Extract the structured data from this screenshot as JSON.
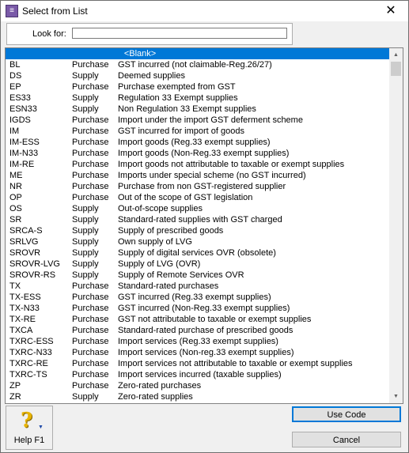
{
  "window": {
    "title": "Select from List",
    "app_icon": "purple-app-icon",
    "close_glyph": "✕"
  },
  "search": {
    "label": "Look for:",
    "value": "",
    "placeholder": ""
  },
  "list": {
    "blank_label": "<Blank>",
    "selected_index": 0,
    "rows": [
      {
        "code": "BL",
        "type": "Purchase",
        "description": "GST incurred (not claimable-Reg.26/27)"
      },
      {
        "code": "DS",
        "type": "Supply",
        "description": "Deemed supplies"
      },
      {
        "code": "EP",
        "type": "Purchase",
        "description": "Purchase exempted from GST"
      },
      {
        "code": "ES33",
        "type": "Supply",
        "description": "Regulation 33 Exempt supplies"
      },
      {
        "code": "ESN33",
        "type": "Supply",
        "description": "Non Regulation 33 Exempt supplies"
      },
      {
        "code": "IGDS",
        "type": "Purchase",
        "description": "Import under the import GST deferment scheme"
      },
      {
        "code": "IM",
        "type": "Purchase",
        "description": "GST incurred for import of goods"
      },
      {
        "code": "IM-ESS",
        "type": "Purchase",
        "description": "Import goods (Reg.33 exempt supplies)"
      },
      {
        "code": "IM-N33",
        "type": "Purchase",
        "description": "Import goods (Non-Reg.33 exempt supplies)"
      },
      {
        "code": "IM-RE",
        "type": "Purchase",
        "description": "Import goods not attributable to taxable or exempt supplies"
      },
      {
        "code": "ME",
        "type": "Purchase",
        "description": "Imports under special scheme (no GST incurred)"
      },
      {
        "code": "NR",
        "type": "Purchase",
        "description": "Purchase from non GST-registered supplier"
      },
      {
        "code": "OP",
        "type": "Purchase",
        "description": "Out of the scope of GST legislation"
      },
      {
        "code": "OS",
        "type": "Supply",
        "description": "Out-of-scope supplies"
      },
      {
        "code": "SR",
        "type": "Supply",
        "description": "Standard-rated supplies with GST charged"
      },
      {
        "code": "SRCA-S",
        "type": "Supply",
        "description": "Supply of prescribed goods"
      },
      {
        "code": "SRLVG",
        "type": "Supply",
        "description": "Own supply of LVG"
      },
      {
        "code": "SROVR",
        "type": "Supply",
        "description": "Supply of digital services OVR (obsolete)"
      },
      {
        "code": "SROVR-LVG",
        "type": "Supply",
        "description": "Supply of LVG (OVR)"
      },
      {
        "code": "SROVR-RS",
        "type": "Supply",
        "description": "Supply of Remote Services OVR"
      },
      {
        "code": "TX",
        "type": "Purchase",
        "description": "Standard-rated purchases"
      },
      {
        "code": "TX-ESS",
        "type": "Purchase",
        "description": "GST incurred (Reg.33 exempt supplies)"
      },
      {
        "code": "TX-N33",
        "type": "Purchase",
        "description": "GST incurred  (Non-Reg.33 exempt supplies)"
      },
      {
        "code": "TX-RE",
        "type": "Purchase",
        "description": "GST not attributable to taxable or exempt supplies"
      },
      {
        "code": "TXCA",
        "type": "Purchase",
        "description": "Standard-rated purchase of prescribed goods"
      },
      {
        "code": "TXRC-ESS",
        "type": "Purchase",
        "description": "Import services (Reg.33 exempt supplies)"
      },
      {
        "code": "TXRC-N33",
        "type": "Purchase",
        "description": "Import services (Non-reg.33 exempt supplies)"
      },
      {
        "code": "TXRC-RE",
        "type": "Purchase",
        "description": "Import services not attributable to taxable or exempt supplies"
      },
      {
        "code": "TXRC-TS",
        "type": "Purchase",
        "description": "Import services incurred (taxable supplies)"
      },
      {
        "code": "ZP",
        "type": "Purchase",
        "description": "Zero-rated purchases"
      },
      {
        "code": "ZR",
        "type": "Supply",
        "description": "Zero-rated supplies"
      }
    ]
  },
  "scrollbar": {
    "up_glyph": "▲",
    "down_glyph": "▼"
  },
  "buttons": {
    "help_label": "Help F1",
    "help_glyph": "?",
    "help_arrow": "▼",
    "use_code_label": "Use Code",
    "cancel_label": "Cancel"
  },
  "colors": {
    "selection": "#0078d7",
    "help_icon": "#e8b400",
    "app_icon": "#7a5aa8"
  }
}
